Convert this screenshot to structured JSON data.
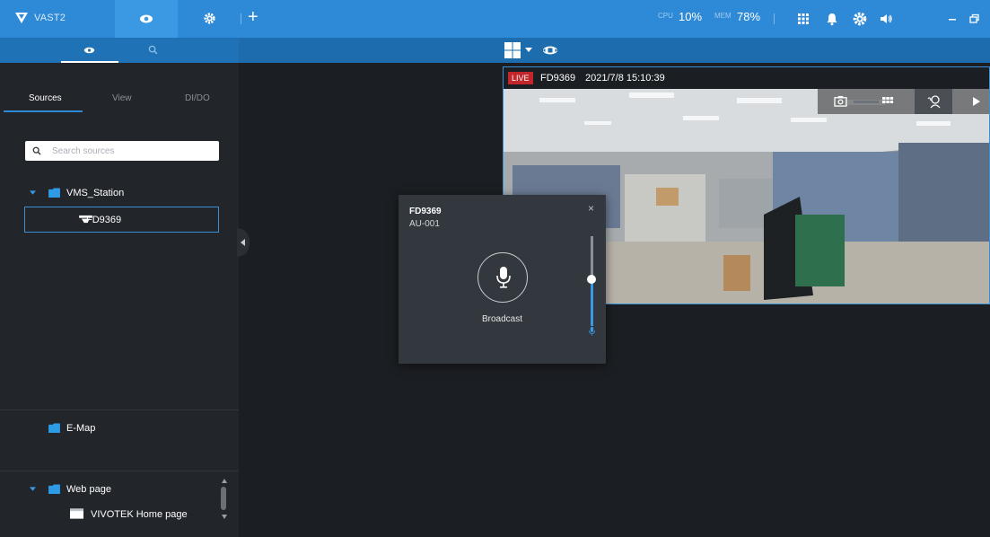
{
  "titlebar": {
    "app_name": "VAST2",
    "add_tab": "+",
    "cpu_label": "CPU",
    "cpu_value": "10%",
    "mem_label": "MEM",
    "mem_value": "78%"
  },
  "icons": [
    "vivotek-logo-icon",
    "eye-icon",
    "gear-icon",
    "grid-icon",
    "bell-icon",
    "volume-icon",
    "minimize-icon",
    "restore-icon",
    "search-icon",
    "layout-icon",
    "chevron-down-icon",
    "ptz-icon",
    "camera-icon",
    "microphone-icon",
    "play-icon",
    "folder-icon",
    "camera-device-icon",
    "webpage-icon"
  ],
  "sidebar": {
    "tabs": [
      "Sources",
      "View",
      "DI/DO"
    ],
    "search_placeholder": "Search sources",
    "station": "VMS_Station",
    "device": "FD9369",
    "emap": "E-Map",
    "webpage_group": "Web page",
    "webpage_item": "VIVOTEK Home page"
  },
  "video": {
    "live": "LIVE",
    "camera": "FD9369",
    "timestamp": "2021/7/8 15:10:39"
  },
  "popup": {
    "title": "FD9369",
    "subtitle": "AU-001",
    "close": "×",
    "action": "Broadcast",
    "volume_fraction": 0.52
  },
  "colors": {
    "accent": "#2e8ad6",
    "live_red": "#c2262b",
    "selection_border": "#3b8ed3"
  }
}
